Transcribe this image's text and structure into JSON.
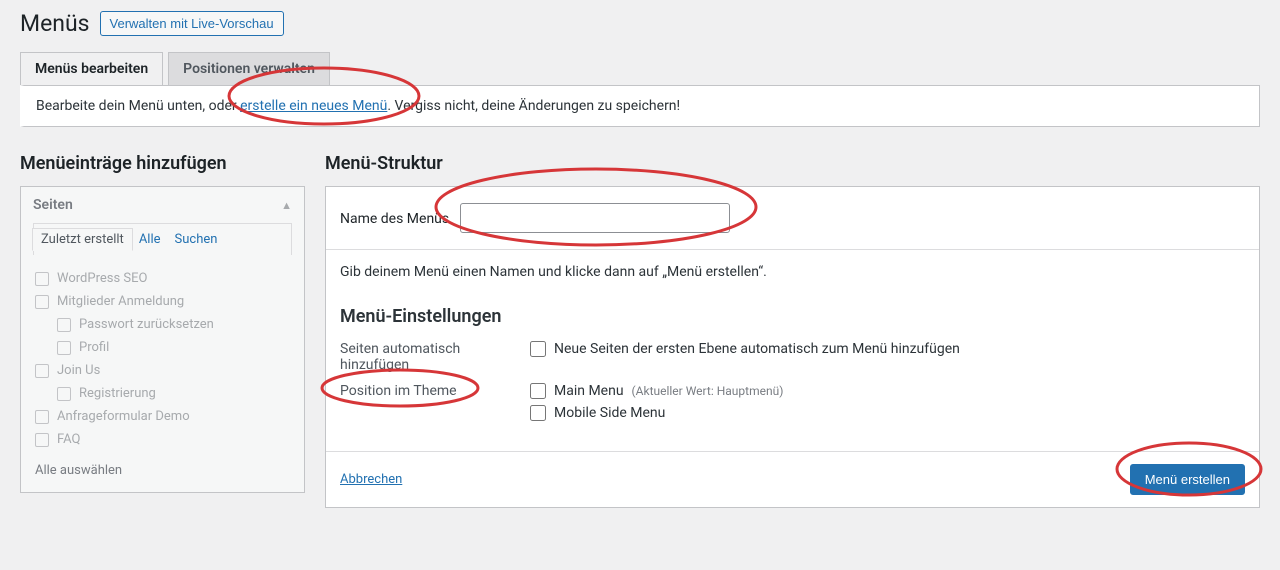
{
  "header": {
    "title": "Menüs",
    "live_preview_button": "Verwalten mit Live-Vorschau"
  },
  "tabs": {
    "edit": "Menüs bearbeiten",
    "manage": "Positionen verwalten"
  },
  "notice": {
    "prefix": "Bearbeite dein Menü unten, oder ",
    "link": "erstelle ein neues Menü",
    "suffix": ". Vergiss nicht, deine Änderungen zu speichern!"
  },
  "left": {
    "heading": "Menüeinträge hinzufügen",
    "metabox_title": "Seiten",
    "subtabs": {
      "recent": "Zuletzt erstellt",
      "all": "Alle",
      "search": "Suchen"
    },
    "pages": [
      {
        "label": "WordPress SEO",
        "indent": false
      },
      {
        "label": "Mitglieder Anmeldung",
        "indent": false
      },
      {
        "label": "Passwort zurücksetzen",
        "indent": true
      },
      {
        "label": "Profil",
        "indent": true
      },
      {
        "label": "Join Us",
        "indent": false
      },
      {
        "label": "Registrierung",
        "indent": true
      },
      {
        "label": "Anfrageformular Demo",
        "indent": false
      },
      {
        "label": "FAQ",
        "indent": false
      }
    ],
    "select_all": "Alle auswählen"
  },
  "right": {
    "heading": "Menü-Struktur",
    "name_label": "Name des Menüs",
    "name_value": "",
    "hint": "Gib deinem Menü einen Namen und klicke dann auf „Menü erstellen“.",
    "settings_title": "Menü-Einstellungen",
    "auto_add_label": "Seiten automatisch hinzufügen",
    "auto_add_option": "Neue Seiten der ersten Ebene automatisch zum Menü hinzufügen",
    "position_label": "Position im Theme",
    "positions": [
      {
        "label": "Main Menu",
        "note": "(Aktueller Wert: Hauptmenü)"
      },
      {
        "label": "Mobile Side Menu",
        "note": ""
      }
    ],
    "cancel": "Abbrechen",
    "create": "Menü erstellen"
  }
}
